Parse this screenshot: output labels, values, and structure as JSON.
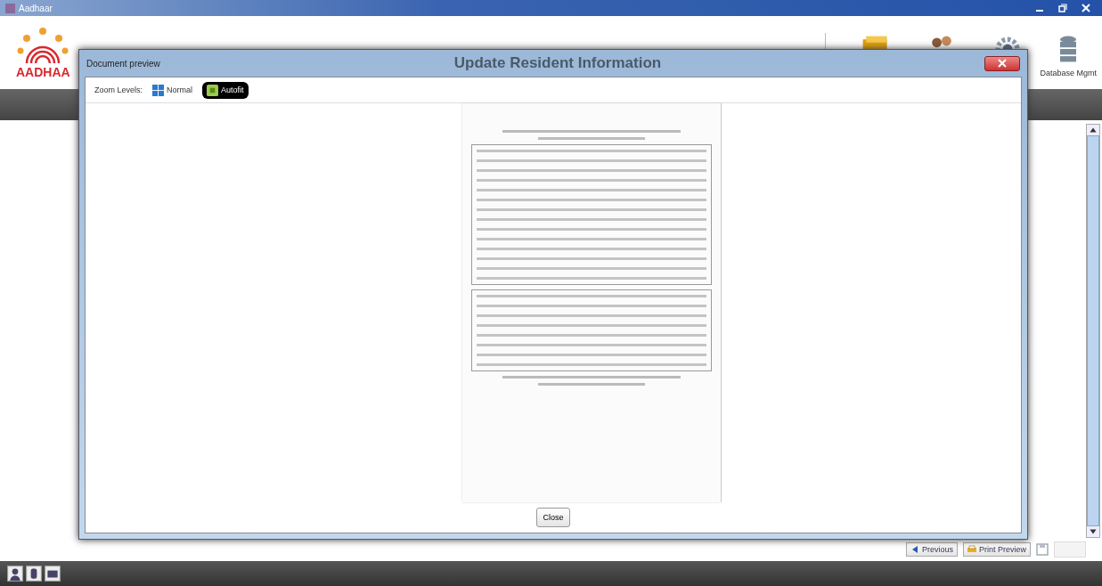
{
  "window": {
    "title": "Aadhaar"
  },
  "header": {
    "logo_text": "AADHAA",
    "title": "Update Resident Information",
    "tool_label": "Database Mgmt"
  },
  "dialog": {
    "title": "Document preview",
    "zoom_label": "Zoom Levels:",
    "zoom_options": [
      {
        "label": "Normal",
        "kind": "normal",
        "selected": false
      },
      {
        "label": "Autofit",
        "kind": "autofit",
        "selected": true
      }
    ],
    "close_button": "Close"
  },
  "footer_buttons": [
    {
      "label": "Previous",
      "kind": "previous"
    },
    {
      "label": "Print Preview",
      "kind": "print"
    }
  ]
}
